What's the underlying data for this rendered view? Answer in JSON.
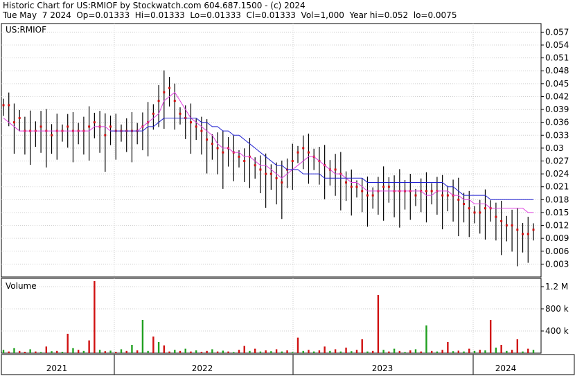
{
  "header": {
    "line1": "Historic Chart for US:RMIOF by Stockwatch.com 604.687.1500 - (c) 2024",
    "line2": "Tue May  7 2024  Op=0.01333  Hi=0.01333  Lo=0.01333  Cl=0.01333  Vol=1,000  Year hi=0.052  lo=0.0075"
  },
  "chart_data": [
    {
      "type": "candlestick",
      "title": "US:RMIOF",
      "y_ticks": [
        "0.057",
        "0.054",
        "0.051",
        "0.048",
        "0.045",
        "0.042",
        "0.039",
        "0.036",
        "0.033",
        "0.03",
        "0.027",
        "0.024",
        "0.021",
        "0.018",
        "0.015",
        "0.012",
        "0.009",
        "0.006",
        "0.003"
      ],
      "ylim": [
        0,
        0.059
      ],
      "grid": true,
      "series": [
        {
          "key": "price",
          "color": "#000000",
          "closes": [
            0.04,
            0.04,
            0.036,
            0.037,
            0.034,
            0.034,
            0.034,
            0.035,
            0.034,
            0.033,
            0.034,
            0.034,
            0.035,
            0.034,
            0.034,
            0.034,
            0.035,
            0.036,
            0.035,
            0.033,
            0.035,
            0.034,
            0.034,
            0.034,
            0.034,
            0.034,
            0.035,
            0.036,
            0.038,
            0.041,
            0.043,
            0.044,
            0.041,
            0.038,
            0.037,
            0.036,
            0.035,
            0.034,
            0.032,
            0.031,
            0.03,
            0.029,
            0.03,
            0.029,
            0.028,
            0.027,
            0.028,
            0.026,
            0.025,
            0.024,
            0.024,
            0.023,
            0.022,
            0.025,
            0.027,
            0.029,
            0.03,
            0.029,
            0.028,
            0.027,
            0.026,
            0.025,
            0.025,
            0.024,
            0.022,
            0.021,
            0.021,
            0.02,
            0.019,
            0.019,
            0.02,
            0.021,
            0.021,
            0.02,
            0.02,
            0.02,
            0.02,
            0.019,
            0.02,
            0.02,
            0.02,
            0.02,
            0.019,
            0.019,
            0.019,
            0.018,
            0.017,
            0.016,
            0.015,
            0.015,
            0.016,
            0.016,
            0.014,
            0.013,
            0.012,
            0.012,
            0.011,
            0.01,
            0.01,
            0.011
          ]
        },
        {
          "key": "ma_short",
          "color": "#e040e0",
          "values": [
            0.037,
            0.036,
            0.035,
            0.034,
            0.034,
            0.034,
            0.034,
            0.034,
            0.034,
            0.034,
            0.034,
            0.034,
            0.034,
            0.034,
            0.034,
            0.034,
            0.034,
            0.035,
            0.035,
            0.035,
            0.034,
            0.034,
            0.034,
            0.034,
            0.034,
            0.034,
            0.035,
            0.036,
            0.037,
            0.038,
            0.041,
            0.042,
            0.043,
            0.041,
            0.039,
            0.037,
            0.036,
            0.035,
            0.034,
            0.033,
            0.031,
            0.03,
            0.03,
            0.029,
            0.029,
            0.028,
            0.028,
            0.027,
            0.026,
            0.026,
            0.025,
            0.024,
            0.023,
            0.024,
            0.025,
            0.026,
            0.027,
            0.028,
            0.028,
            0.027,
            0.026,
            0.025,
            0.024,
            0.024,
            0.023,
            0.022,
            0.022,
            0.021,
            0.02,
            0.02,
            0.02,
            0.02,
            0.02,
            0.02,
            0.02,
            0.02,
            0.02,
            0.02,
            0.02,
            0.019,
            0.019,
            0.02,
            0.02,
            0.02,
            0.019,
            0.019,
            0.018,
            0.018,
            0.017,
            0.017,
            0.017,
            0.016,
            0.016,
            0.016,
            0.016,
            0.016,
            0.016,
            0.016,
            0.015,
            0.015
          ]
        },
        {
          "key": "ma_long",
          "color": "#2020d0",
          "values": [
            null,
            null,
            null,
            null,
            null,
            null,
            null,
            null,
            null,
            null,
            null,
            null,
            null,
            null,
            null,
            null,
            null,
            null,
            null,
            null,
            0.034,
            0.034,
            0.034,
            0.034,
            0.034,
            0.034,
            0.034,
            0.035,
            0.035,
            0.036,
            0.037,
            0.037,
            0.037,
            0.037,
            0.037,
            0.037,
            0.037,
            0.036,
            0.036,
            0.035,
            0.035,
            0.034,
            0.034,
            0.033,
            0.033,
            0.032,
            0.031,
            0.03,
            0.029,
            0.028,
            0.027,
            0.026,
            0.026,
            0.025,
            0.025,
            0.025,
            0.024,
            0.024,
            0.024,
            0.024,
            0.023,
            0.023,
            0.023,
            0.023,
            0.023,
            0.023,
            0.023,
            0.023,
            0.022,
            0.022,
            0.022,
            0.022,
            0.022,
            0.022,
            0.022,
            0.022,
            0.022,
            0.022,
            0.022,
            0.022,
            0.022,
            0.022,
            0.022,
            0.021,
            0.021,
            0.02,
            0.019,
            0.019,
            0.019,
            0.019,
            0.019,
            0.018,
            0.018,
            0.018,
            0.018,
            0.018,
            0.018,
            0.018,
            0.018,
            0.018
          ]
        }
      ]
    },
    {
      "type": "bar",
      "title": "Volume",
      "y_ticks": [
        "1.2 M",
        "800 k",
        "400 k"
      ],
      "ylim": [
        0,
        1350000
      ],
      "grid": true,
      "up_color": "#20a020",
      "down_color": "#d01010",
      "values": [
        60000,
        30000,
        90000,
        40000,
        25000,
        70000,
        30000,
        20000,
        120000,
        35000,
        40000,
        25000,
        350000,
        90000,
        60000,
        40000,
        230000,
        1300000,
        60000,
        35000,
        45000,
        25000,
        70000,
        40000,
        150000,
        50000,
        600000,
        40000,
        300000,
        200000,
        140000,
        30000,
        60000,
        40000,
        80000,
        30000,
        50000,
        25000,
        40000,
        70000,
        30000,
        45000,
        30000,
        20000,
        60000,
        130000,
        40000,
        80000,
        30000,
        50000,
        35000,
        70000,
        30000,
        50000,
        20000,
        280000,
        40000,
        60000,
        30000,
        50000,
        120000,
        40000,
        70000,
        30000,
        100000,
        35000,
        60000,
        250000,
        30000,
        40000,
        1050000,
        60000,
        30000,
        80000,
        40000,
        20000,
        50000,
        70000,
        30000,
        500000,
        40000,
        30000,
        60000,
        200000,
        35000,
        45000,
        30000,
        80000,
        40000,
        60000,
        50000,
        600000,
        100000,
        150000,
        40000,
        60000,
        250000,
        30000,
        80000,
        60000
      ],
      "colors": [
        "up",
        "down",
        "up",
        "down",
        "down",
        "up",
        "down",
        "up",
        "down",
        "up",
        "down",
        "up",
        "down",
        "up",
        "down",
        "up",
        "down",
        "down",
        "up",
        "down",
        "up",
        "down",
        "up",
        "down",
        "up",
        "down",
        "up",
        "up",
        "down",
        "up",
        "down",
        "down",
        "up",
        "down",
        "up",
        "down",
        "up",
        "down",
        "down",
        "up",
        "down",
        "up",
        "down",
        "up",
        "down",
        "down",
        "up",
        "down",
        "up",
        "down",
        "up",
        "down",
        "up",
        "down",
        "up",
        "down",
        "up",
        "down",
        "up",
        "down",
        "down",
        "up",
        "down",
        "up",
        "down",
        "up",
        "down",
        "down",
        "up",
        "down",
        "down",
        "up",
        "down",
        "up",
        "down",
        "up",
        "down",
        "up",
        "down",
        "up",
        "down",
        "up",
        "down",
        "down",
        "up",
        "down",
        "up",
        "down",
        "up",
        "down",
        "up",
        "down",
        "up",
        "down",
        "up",
        "down",
        "down",
        "up",
        "down",
        "up"
      ]
    }
  ],
  "x_axis": {
    "labels": [
      "2021",
      "2022",
      "2023",
      "2024"
    ]
  }
}
